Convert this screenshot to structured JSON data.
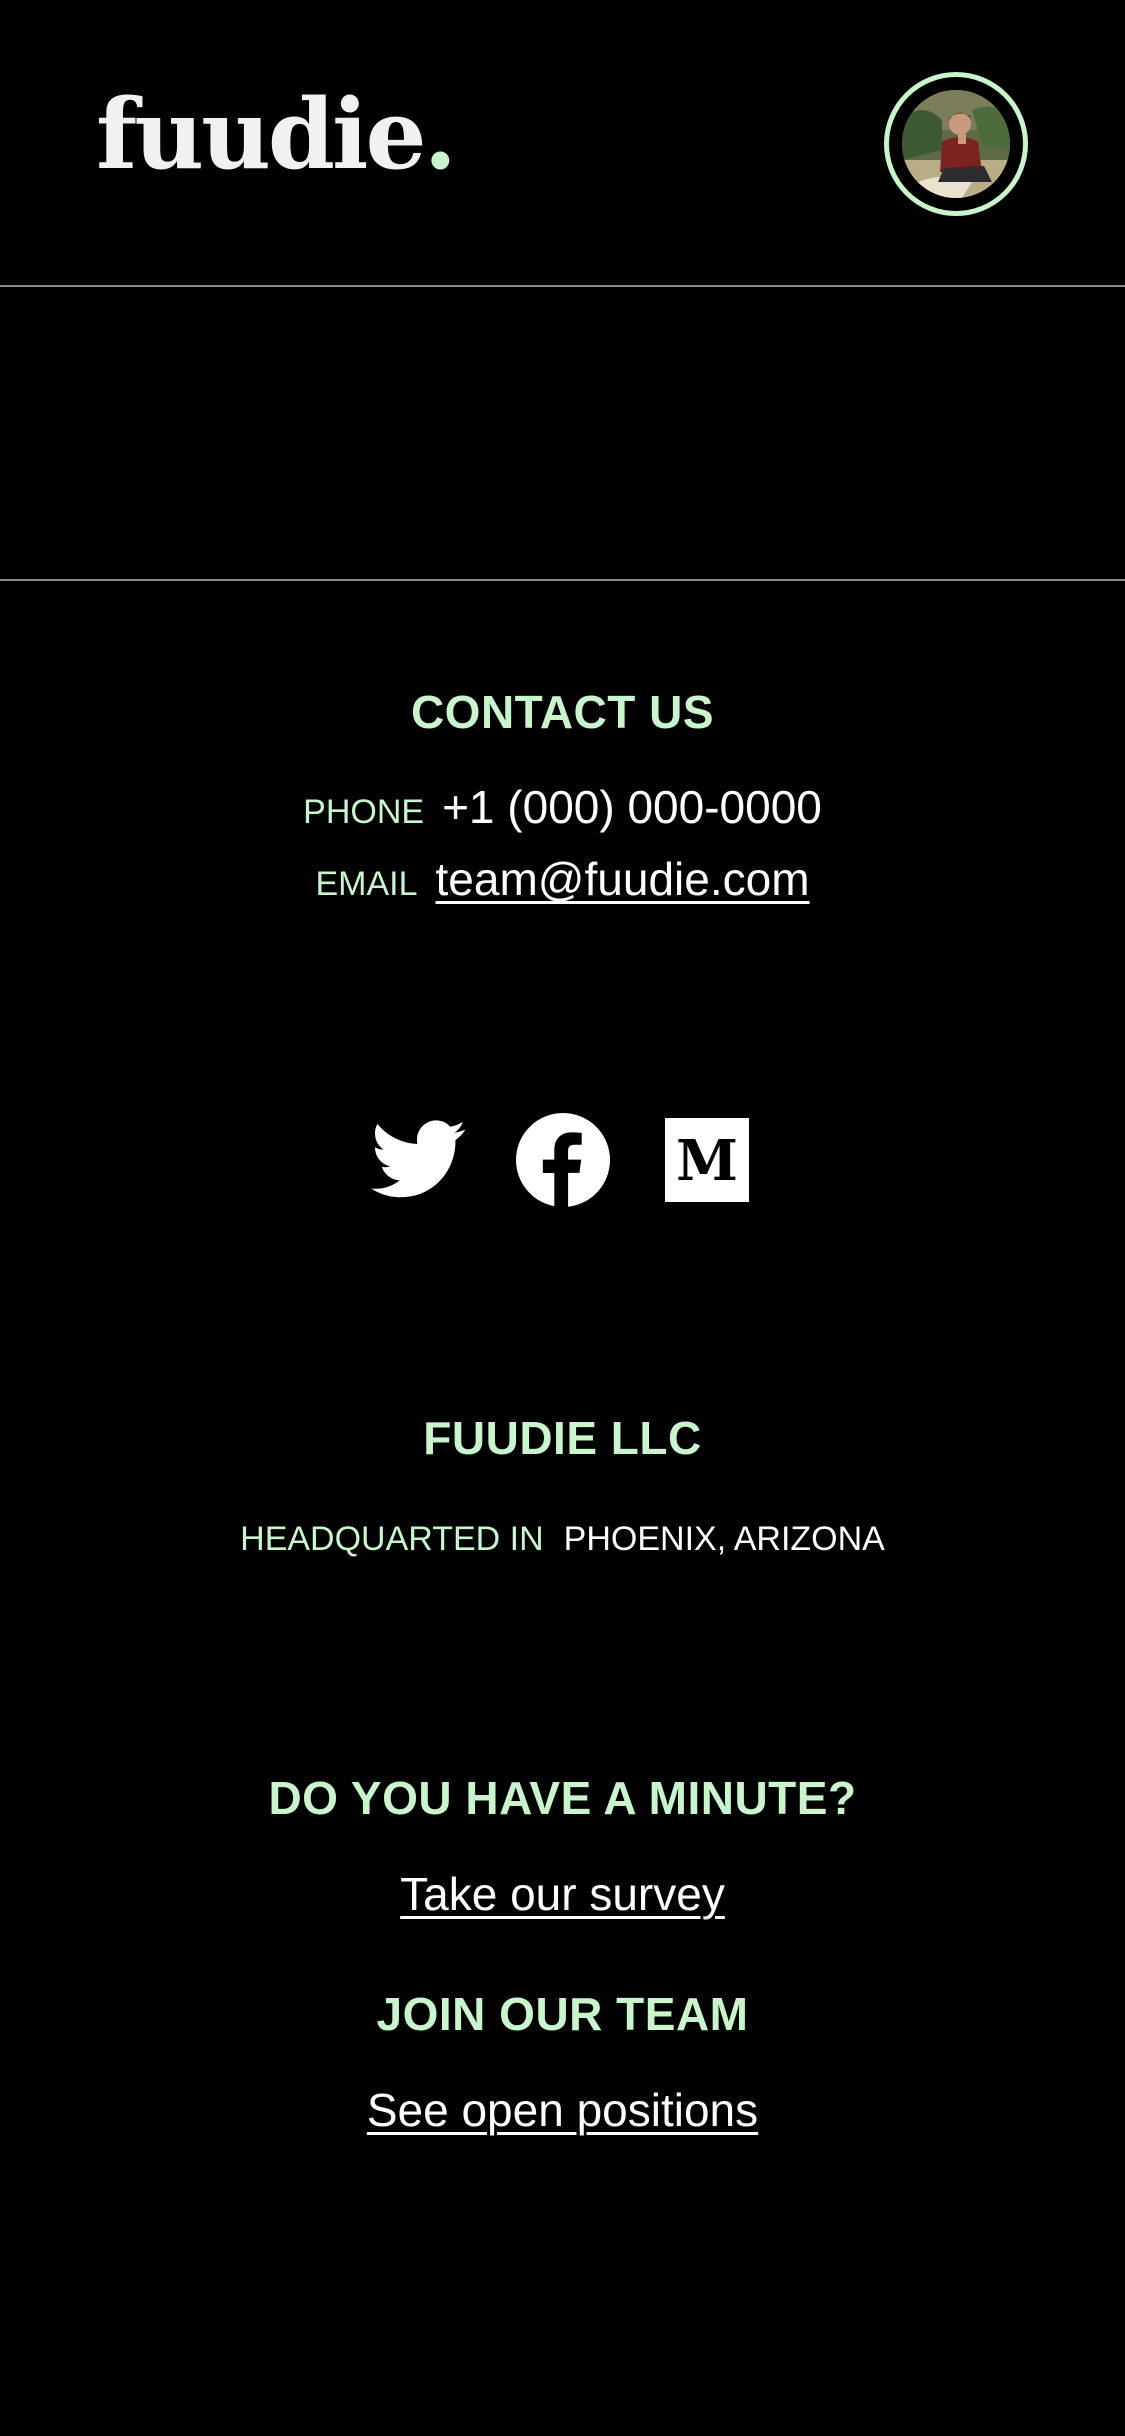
{
  "header": {
    "logo_text": "fuudie",
    "logo_dot": ".",
    "avatar_icon": "user-avatar-photo"
  },
  "contact": {
    "title": "CONTACT US",
    "phone_label": "PHONE",
    "phone_value": "+1 (000) 000-0000",
    "email_label": "EMAIL",
    "email_value": "team@fuudie.com"
  },
  "socials": [
    {
      "name": "twitter-icon",
      "label": "Twitter"
    },
    {
      "name": "facebook-icon",
      "label": "Facebook"
    },
    {
      "name": "medium-icon",
      "label": "Medium"
    }
  ],
  "company": {
    "title": "FUUDIE LLC",
    "hq_label": "HEADQUARTED IN",
    "hq_value": "PHOENIX, ARIZONA"
  },
  "survey": {
    "title": "DO YOU HAVE A MINUTE?",
    "link_text": "Take our survey"
  },
  "team": {
    "title": "JOIN OUR TEAM",
    "link_text": "See open positions"
  },
  "colors": {
    "background": "#000000",
    "accent": "#c8f5cc",
    "text": "#ffffff",
    "divider": "#8a8a8a"
  }
}
